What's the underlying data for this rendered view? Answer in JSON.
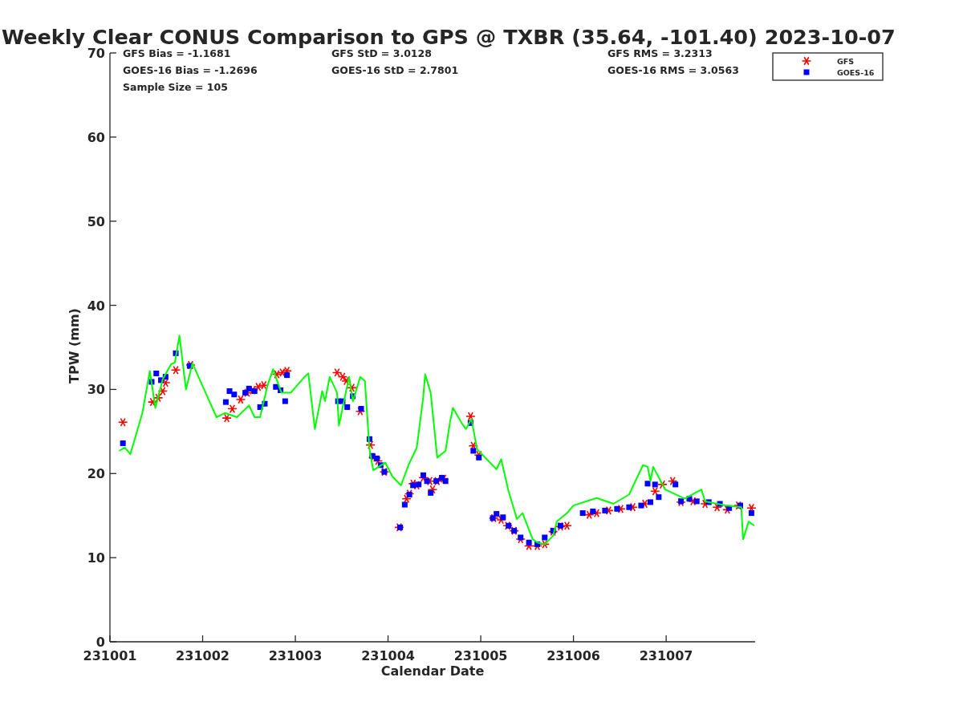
{
  "chart_data": {
    "type": "scatter",
    "title": "Weekly Clear CONUS Comparison to GPS @ TXBR (35.64, -101.40) 2023-10-07",
    "xlabel": "Calendar Date",
    "ylabel": "TPW (mm)",
    "xlim": [
      231001,
      231007.96
    ],
    "ylim": [
      0,
      70
    ],
    "xticks": [
      231001,
      231002,
      231003,
      231004,
      231005,
      231006,
      231007
    ],
    "yticks": [
      0,
      10,
      20,
      30,
      40,
      50,
      60,
      70
    ],
    "series": [
      {
        "name": "GFS",
        "color": "#ff0000",
        "marker": "cross",
        "x": [
          231001.14,
          231001.46,
          231001.52,
          231001.57,
          231001.6,
          231001.71,
          231001.87,
          231002.26,
          231002.32,
          231002.41,
          231002.48,
          231002.54,
          231002.6,
          231002.66,
          231002.8,
          231002.86,
          231002.91,
          231003.45,
          231003.51,
          231003.55,
          231003.61,
          231003.7,
          231003.81,
          231003.84,
          231003.89,
          231003.96,
          231004.12,
          231004.2,
          231004.23,
          231004.27,
          231004.31,
          231004.38,
          231004.45,
          231004.48,
          231004.53,
          231004.6,
          231004.89,
          231004.92,
          231004.98,
          231005.14,
          231005.22,
          231005.29,
          231005.36,
          231005.43,
          231005.52,
          231005.61,
          231005.69,
          231005.78,
          231005.86,
          231005.93,
          231006.17,
          231006.25,
          231006.38,
          231006.51,
          231006.64,
          231006.77,
          231006.88,
          231006.96,
          231007.07,
          231007.16,
          231007.29,
          231007.42,
          231007.55,
          231007.66,
          231007.78,
          231007.92
        ],
        "values": [
          26.1,
          28.5,
          29.0,
          29.8,
          30.8,
          32.3,
          32.9,
          26.6,
          27.7,
          28.8,
          29.6,
          29.9,
          30.3,
          30.5,
          31.8,
          32.0,
          32.2,
          32.0,
          31.5,
          31.0,
          30.2,
          27.4,
          23.4,
          21.9,
          21.5,
          20.2,
          13.6,
          17.0,
          17.6,
          18.8,
          18.6,
          19.5,
          19.1,
          18.1,
          19.1,
          19.4,
          26.8,
          23.3,
          22.2,
          14.7,
          14.5,
          13.8,
          13.2,
          12.2,
          11.4,
          11.4,
          11.6,
          13.1,
          13.7,
          13.8,
          15.1,
          15.3,
          15.6,
          15.8,
          16.0,
          16.4,
          17.9,
          18.7,
          19.1,
          16.6,
          16.7,
          16.4,
          16.0,
          15.7,
          16.2,
          15.9
        ]
      },
      {
        "name": "GOES-16",
        "color": "#0000ff",
        "marker": "square",
        "x": [
          231001.14,
          231001.45,
          231001.5,
          231001.55,
          231001.6,
          231001.71,
          231001.86,
          231002.25,
          231002.29,
          231002.34,
          231002.46,
          231002.5,
          231002.56,
          231002.62,
          231002.67,
          231002.79,
          231002.84,
          231002.89,
          231002.91,
          231003.46,
          231003.51,
          231003.56,
          231003.62,
          231003.71,
          231003.8,
          231003.83,
          231003.88,
          231003.92,
          231003.96,
          231004.13,
          231004.18,
          231004.23,
          231004.27,
          231004.33,
          231004.38,
          231004.42,
          231004.46,
          231004.52,
          231004.58,
          231004.62,
          231004.89,
          231004.92,
          231004.98,
          231005.13,
          231005.17,
          231005.24,
          231005.3,
          231005.36,
          231005.43,
          231005.52,
          231005.61,
          231005.69,
          231005.78,
          231005.86,
          231006.1,
          231006.21,
          231006.34,
          231006.47,
          231006.6,
          231006.73,
          231006.8,
          231006.83,
          231006.88,
          231006.92,
          231007.1,
          231007.16,
          231007.25,
          231007.33,
          231007.46,
          231007.58,
          231007.68,
          231007.8,
          231007.92
        ],
        "values": [
          23.6,
          30.9,
          31.9,
          31.1,
          31.5,
          34.3,
          32.8,
          28.5,
          29.8,
          29.4,
          29.6,
          30.1,
          29.8,
          27.9,
          28.3,
          30.3,
          29.9,
          28.6,
          31.7,
          28.6,
          28.6,
          27.9,
          29.2,
          27.7,
          24.1,
          22.1,
          21.8,
          21.0,
          20.2,
          13.6,
          16.3,
          17.5,
          18.6,
          18.7,
          19.8,
          19.1,
          17.7,
          19.1,
          19.5,
          19.1,
          26.0,
          22.7,
          21.9,
          14.7,
          15.2,
          14.8,
          13.8,
          13.2,
          12.4,
          11.8,
          11.6,
          12.4,
          13.2,
          13.8,
          15.3,
          15.5,
          15.6,
          15.8,
          16.0,
          16.2,
          18.8,
          16.6,
          18.7,
          17.2,
          18.7,
          16.7,
          17.0,
          16.7,
          16.6,
          16.4,
          15.9,
          16.2,
          15.3
        ]
      },
      {
        "color": "#00ff00",
        "type": "line",
        "x": [
          231001.1,
          231001.16,
          231001.22,
          231001.35,
          231001.43,
          231001.49,
          231001.57,
          231001.66,
          231001.7,
          231001.75,
          231001.82,
          231001.89,
          231002.15,
          231002.24,
          231002.37,
          231002.5,
          231002.56,
          231002.62,
          231002.7,
          231002.76,
          231002.85,
          231002.95,
          231003.1,
          231003.14,
          231003.21,
          231003.29,
          231003.32,
          231003.37,
          231003.45,
          231003.47,
          231003.58,
          231003.62,
          231003.7,
          231003.75,
          231003.8,
          231003.84,
          231003.97,
          231004.05,
          231004.14,
          231004.22,
          231004.31,
          231004.38,
          231004.4,
          231004.46,
          231004.53,
          231004.62,
          231004.67,
          231004.7,
          231004.8,
          231004.84,
          231004.9,
          231004.96,
          231005.17,
          231005.22,
          231005.3,
          231005.39,
          231005.45,
          231005.56,
          231005.61,
          231005.69,
          231005.78,
          231005.82,
          231005.93,
          231006.0,
          231006.25,
          231006.43,
          231006.6,
          231006.75,
          231006.8,
          231006.83,
          231006.86,
          231006.99,
          231007.2,
          231007.38,
          231007.42,
          231007.64,
          231007.81,
          231007.83,
          231007.89,
          231007.95
        ],
        "values": [
          22.7,
          23.1,
          22.3,
          27.2,
          32.2,
          27.8,
          31.2,
          33.0,
          33.2,
          36.4,
          30.0,
          33.1,
          26.7,
          27.2,
          26.7,
          28.1,
          26.7,
          26.7,
          30.5,
          32.4,
          29.6,
          29.6,
          31.5,
          31.9,
          25.3,
          29.8,
          28.6,
          31.5,
          29.6,
          25.7,
          31.5,
          28.6,
          31.5,
          31.0,
          22.9,
          20.4,
          21.3,
          19.6,
          18.6,
          21.0,
          23.1,
          29.1,
          31.8,
          29.6,
          21.9,
          22.7,
          26.2,
          27.8,
          25.9,
          25.3,
          26.5,
          22.9,
          20.5,
          21.7,
          17.9,
          14.6,
          15.3,
          12.2,
          11.8,
          11.6,
          12.6,
          14.3,
          15.3,
          16.2,
          17.1,
          16.4,
          17.5,
          21.0,
          20.8,
          19.1,
          20.8,
          18.1,
          17.0,
          18.1,
          16.7,
          16.2,
          16.0,
          12.2,
          14.3,
          13.8
        ]
      }
    ],
    "annotations": [
      "GFS Bias = -1.1681",
      "GFS StD = 3.0128",
      "GFS RMS = 3.2313",
      "GOES-16 Bias = -1.2696",
      "GOES-16 StD = 2.7801",
      "GOES-16 RMS = 3.0563",
      "Sample Size = 105"
    ]
  }
}
